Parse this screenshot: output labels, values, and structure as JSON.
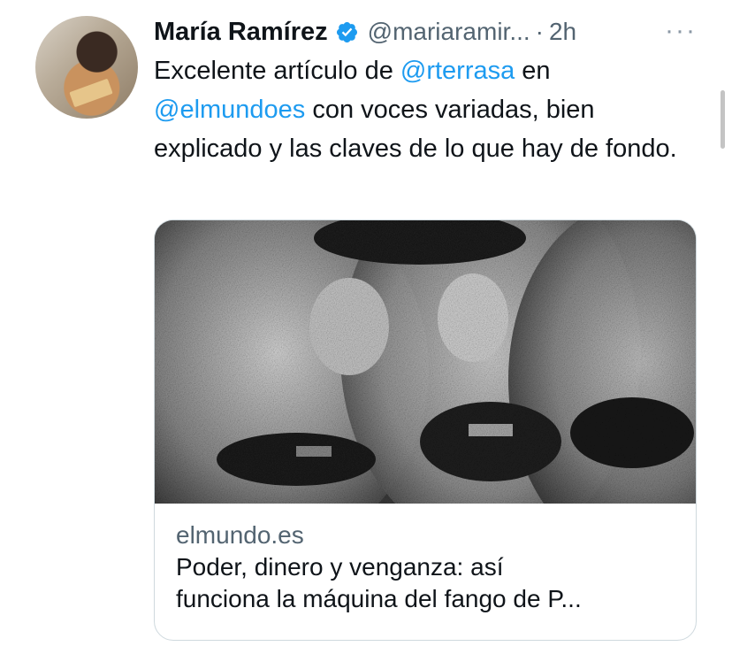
{
  "author": {
    "name": "María Ramírez",
    "handle": "@mariaramir...",
    "separator": "·",
    "time": "2h",
    "verified_color": "#1d9bf0"
  },
  "menu": {
    "more_label": "···"
  },
  "tweet": {
    "text_parts": [
      {
        "text": "Excelente artículo de ",
        "type": "plain"
      },
      {
        "text": "@rterrasa",
        "type": "mention"
      },
      {
        "text": " en ",
        "type": "plain"
      },
      {
        "text": "@elmundoes",
        "type": "mention"
      },
      {
        "text": " con voces variadas, bien explicado y las claves de lo que hay de fondo.",
        "type": "plain"
      }
    ]
  },
  "card": {
    "domain": "elmundo.es",
    "title_line1": "Poder, dinero y venganza: así",
    "title_line2": "funciona la máquina del fango de P..."
  },
  "colors": {
    "mention": "#1d9bf0",
    "secondary_text": "#536471",
    "border": "#cfd9de"
  }
}
